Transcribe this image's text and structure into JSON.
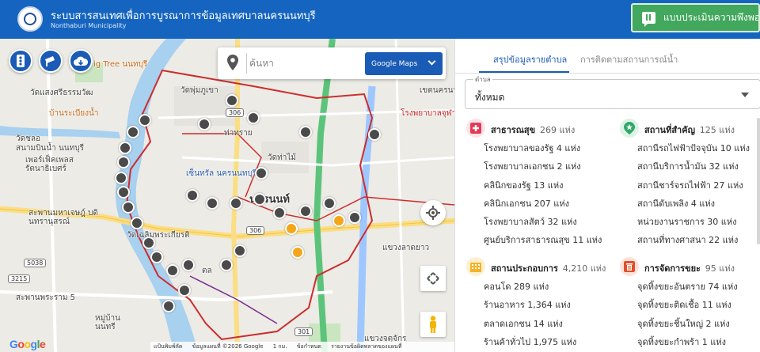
{
  "header": {
    "title": "ระบบสารสนเทศเพื่อการบูรณาการข้อมูลเทศบาลนครนนทบุรี",
    "subtitle": "Nonthaburi Municipality",
    "survey_button": "แบบประเมินความพึงพอใจ"
  },
  "map": {
    "search_placeholder": "ค้นหา",
    "maptype_button": "Google Maps",
    "labels": {
      "flying_tree": "ig Tree นนทบุรี",
      "wat_sangsi": "วัดแสงศรีธรรมวัฒ",
      "baan_rabiang": "บ้านระเบียงน้ำ",
      "wat_chaluem": "วัดชลอ",
      "sanambinnam": "สนามบินน้ำ นนทบุรี",
      "pier": "เพอร์เฟ็คเพลส รัตนาธิเบศร์",
      "central": "เซ็นทรัล นครนนทบุรี",
      "wat_phu": "วัดพุ่มภูเขา",
      "nakhon_non": "นครนนท์",
      "tha_sai": "ท่าทราย",
      "rong_phayaban": "โรงพยาบาลจุฬาภ",
      "khet_nakhon": "เขตนครนนทบุรี",
      "khet_la": "เขตล",
      "saphan_maha": "สะพานมหาเจษฎ์ บดินทรานุสรณ์",
      "saphan_phra": "สะพานพระราม 5",
      "nonthaburi_short": "นนทบุรี",
      "wat_chaloem": "วัดเฉลิมพระเกียรติ",
      "nonthaburi_city": "นนทบุรี",
      "nonban": "หมู่บ้าน นนทรี",
      "lad_yao": "แขวงลาดยาว",
      "chatuchak": "แขวงจตุจักร",
      "tonrad": "ตล",
      "wat_tha": "วัดท่าไม้",
      "khlong": "คลองประปา"
    },
    "route_shields": [
      "306",
      "306",
      "3215",
      "5038",
      "301"
    ],
    "footer": {
      "logo": "Google",
      "shortcuts": "แป้นพิมพ์ลัด",
      "copyright": "ข้อมูลแผนที่ ©2026 Google",
      "scale": "1 กม.",
      "terms": "ข้อกำหนด",
      "report": "รายงานข้อผิดพลาดของแผนที่"
    }
  },
  "panel": {
    "tabs": [
      "สรุปข้อมูลรายตำบล",
      "การติดตามสถานการณ์น้ำ"
    ],
    "district_label": "ตำบล",
    "district_value": "ทั้งหมด",
    "categories": [
      {
        "title": "สาธารณสุข",
        "count": "269 แห่ง",
        "color": "#e53958",
        "icon": "medical-cross-icon",
        "items": [
          "โรงพยาบาลของรัฐ 4 แห่ง",
          "โรงพยาบาลเอกชน 2 แห่ง",
          "คลินิกของรัฐ 13 แห่ง",
          "คลินิกเอกชน 207 แห่ง",
          "โรงพยาบาลสัตว์ 32 แห่ง",
          "ศูนย์บริการสาธารณสุข 11 แห่ง"
        ]
      },
      {
        "title": "สถานที่สำคัญ",
        "count": "125 แห่ง",
        "color": "#2fa86b",
        "icon": "star-pin-icon",
        "items": [
          "สถานีรถไฟฟ้าปัจจุบัน 10 แห่ง",
          "สถานีบริการน้ำมัน 32 แห่ง",
          "สถานีชาร์จรถไฟฟ้า 27 แห่ง",
          "สถานีดับเพลิง 4 แห่ง",
          "หน่วยงานราชการ 30 แห่ง",
          "สถานที่ทางศาสนา 22 แห่ง"
        ]
      },
      {
        "title": "สถานประกอบการ",
        "count": "4,210 แห่ง",
        "color": "#f4b32a",
        "icon": "building-icon",
        "items": [
          "คอนโด 289 แห่ง",
          "ร้านอาหาร 1,364 แห่ง",
          "ตลาดเอกชน 14 แห่ง",
          "ร้านค้าทั่วไป 1,975 แห่ง"
        ]
      },
      {
        "title": "การจัดการขยะ",
        "count": "95 แห่ง",
        "color": "#e0502a",
        "icon": "trash-bin-icon",
        "items": [
          "จุดทิ้งขยะอันตราย 74 แห่ง",
          "จุดทิ้งขยะติดเชื้อ 11 แห่ง",
          "จุดทิ้งขยะชิ้นใหญ่ 2 แห่ง",
          "จุดทิ้งขยะกำพร้า 1 แห่ง"
        ]
      }
    ]
  }
}
